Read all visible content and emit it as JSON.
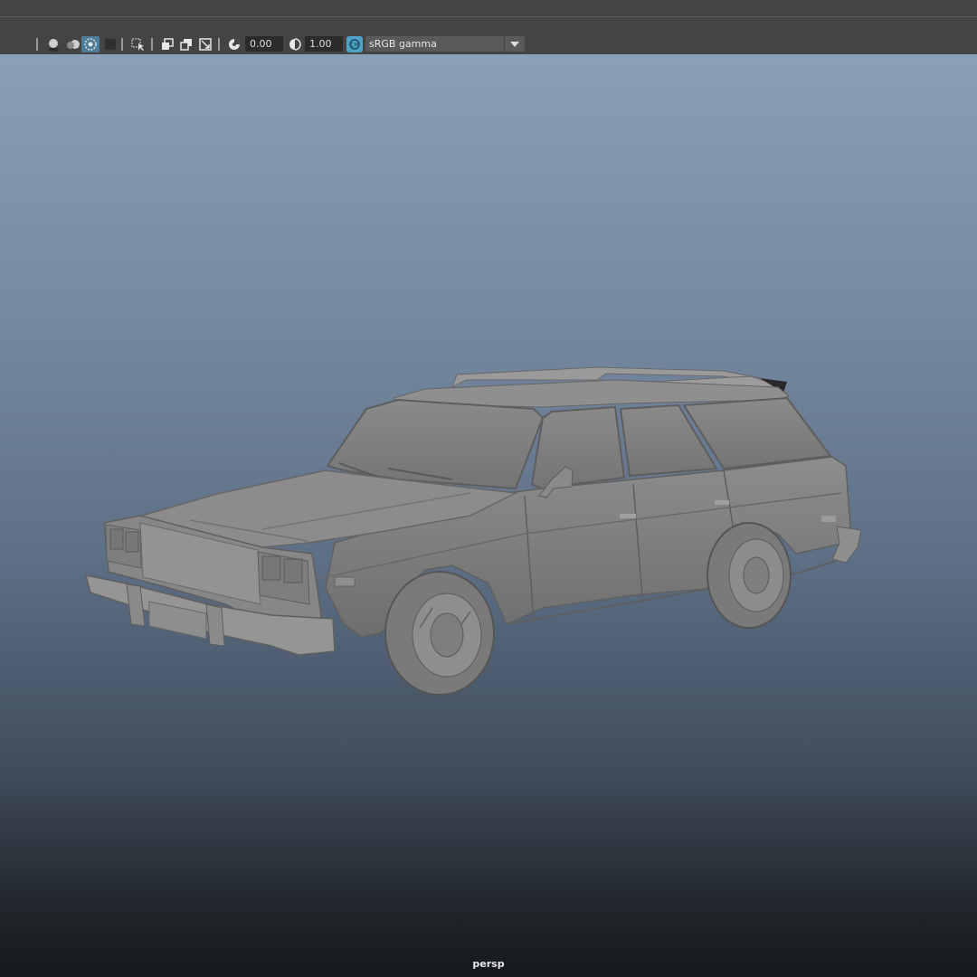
{
  "toolbar": {
    "exposure_value": "0.00",
    "gamma_value": "1.00",
    "color_space": "sRGB gamma",
    "icons": [
      "light-icon",
      "shadow-icon",
      "ambient-occlusion-icon",
      "motion-blur-icon",
      "isolate-select-icon",
      "xray-icon",
      "select-camera-icon",
      "resolution-gate-icon",
      "gate-mask-icon",
      "field-chart-icon",
      "exposure-icon",
      "gamma-icon",
      "color-management-icon"
    ]
  },
  "viewport": {
    "camera_label": "persp",
    "model": "station-wagon"
  },
  "colors": {
    "ui_bg": "#444444",
    "field_bg": "#2b2b2b",
    "accent": "#4fa3c7",
    "viewport_top": "#8aa0b8",
    "viewport_bottom": "#16191c"
  }
}
